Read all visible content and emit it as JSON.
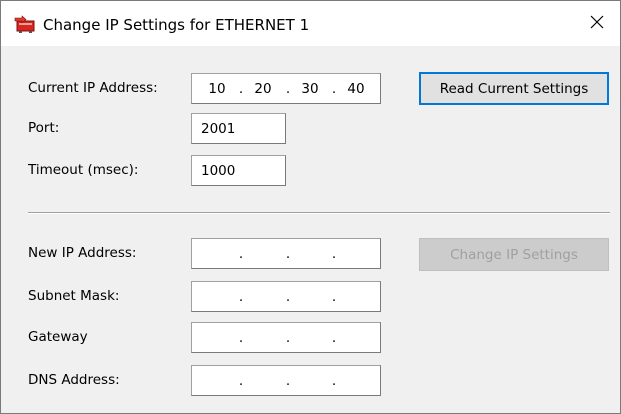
{
  "window": {
    "title": "Change IP Settings for ETHERNET 1",
    "close_glyph": "✕"
  },
  "current": {
    "ip_label": "Current IP Address:",
    "ip": [
      "10",
      "20",
      "30",
      "40"
    ],
    "ip_dot": ".",
    "port_label": "Port:",
    "port_value": "2001",
    "timeout_label": "Timeout (msec):",
    "timeout_value": "1000",
    "read_button": "Read Current Settings"
  },
  "new_settings": {
    "ip_label": "New IP Address:",
    "subnet_label": "Subnet Mask:",
    "gateway_label": "Gateway",
    "dns_label": "DNS Address:",
    "dot": ".",
    "change_button": "Change IP Settings"
  },
  "colors": {
    "accent": "#0078d7",
    "icon_red": "#d9251d",
    "disabled_text": "#a0a0a0"
  }
}
